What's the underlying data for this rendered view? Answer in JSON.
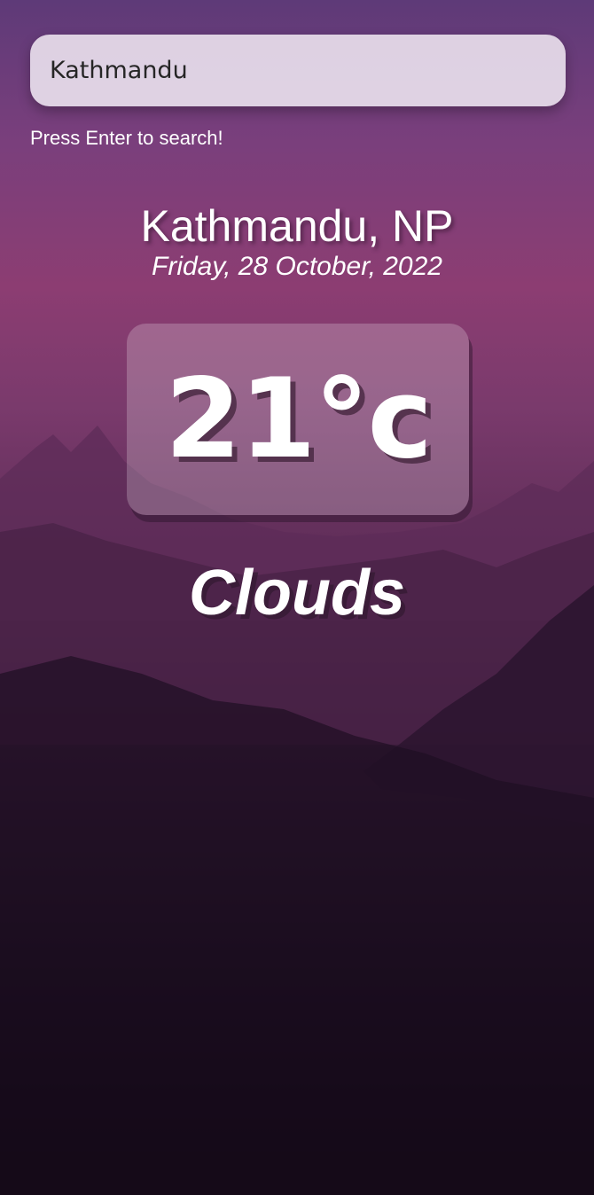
{
  "search": {
    "value": "Kathmandu",
    "hint": "Press Enter to search!"
  },
  "weather": {
    "location": "Kathmandu, NP",
    "date": "Friday, 28 October, 2022",
    "temperature": "21°c",
    "condition": "Clouds"
  },
  "background": {
    "icon": "mountain-landscape",
    "colors": [
      "#5e3a78",
      "#8c3d72",
      "#3e1d3e",
      "#000000"
    ]
  }
}
